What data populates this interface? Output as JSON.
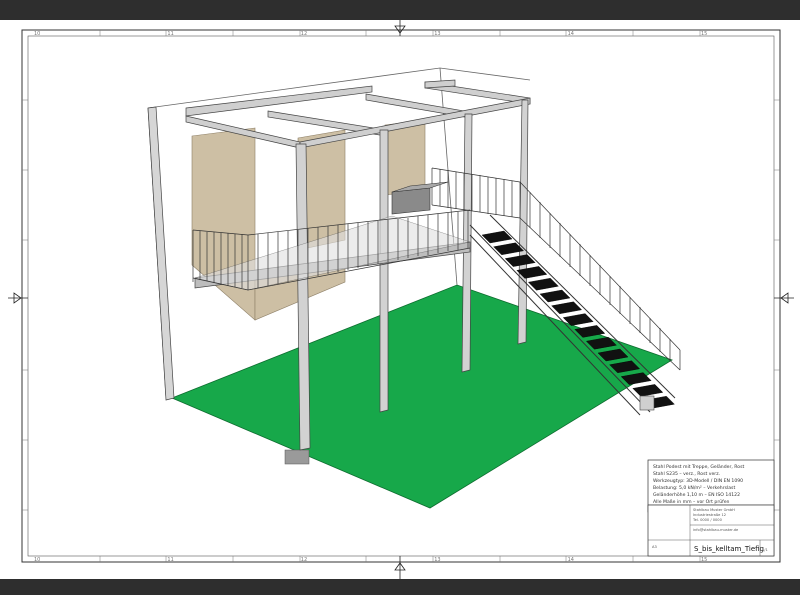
{
  "title_block": {
    "lines": [
      "Stahl Podest mit Treppe, Geländer, Rost",
      "Stahl S235 – verz., Rost verz.",
      "Werkzeugtyp: 3D-Modell / DIN EN 1090",
      "Belastung: 5,0 kN/m² – Verkehrslast",
      "Geländerhöhe 1,10 m – EN ISO 14122",
      "Alle Maße in mm – vor Ort prüfen"
    ],
    "company_lines": [
      "Stahlbau Muster GmbH",
      "Industriestraße 12",
      "Tel. 0000 / 0000",
      "info@stahlbau-muster.de"
    ],
    "drawing_name": "S_bis_kelltam_Tiefig",
    "sheet_number": "1/1",
    "format_note": "A3"
  },
  "frame": {
    "top_ticks": [
      "10",
      "",
      "11",
      "",
      "12",
      "",
      "13",
      "",
      "14",
      "",
      "15",
      ""
    ],
    "bottom_ticks": [
      "10",
      "",
      "11",
      "",
      "12",
      "",
      "13",
      "",
      "14",
      "",
      "15",
      ""
    ]
  },
  "colors": {
    "floor": "#17a84a",
    "wall_panel": "#cdbfa4",
    "steel": "#c8c8c8",
    "steel_edge": "#444444",
    "tread": "#111111"
  }
}
